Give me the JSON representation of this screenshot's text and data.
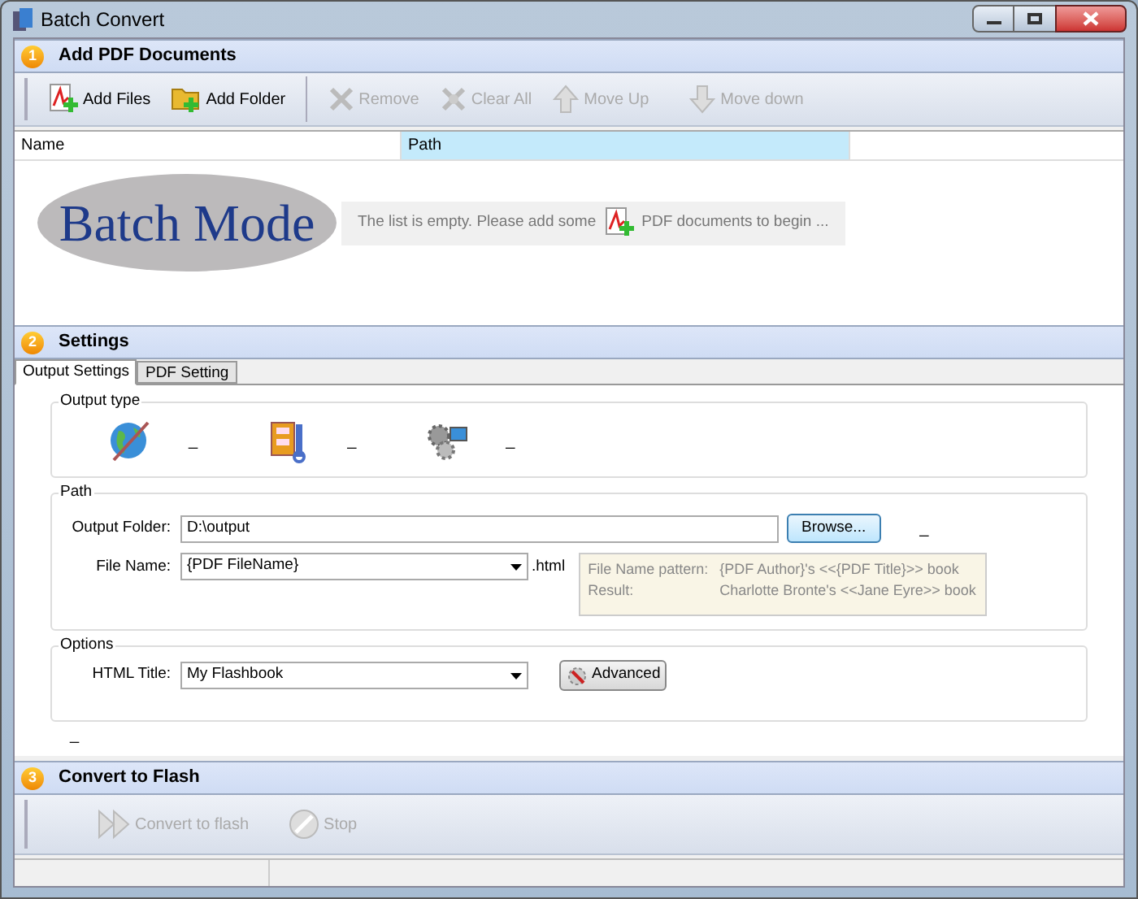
{
  "window": {
    "title": "Batch Convert"
  },
  "add_section": {
    "number": "1",
    "title": "Add PDF Documents",
    "toolbar": [
      {
        "kind": "pdf",
        "label": "Add Files",
        "disabled": false
      },
      {
        "kind": "folder",
        "label": "Add Folder",
        "disabled": false
      },
      {
        "kind": "remove",
        "label": "Remove",
        "disabled": true
      },
      {
        "kind": "clear",
        "label": "Clear All",
        "disabled": true
      },
      {
        "kind": "up",
        "label": "Move Up",
        "disabled": true
      },
      {
        "kind": "down",
        "label": "Move down",
        "disabled": true
      }
    ],
    "columns": [
      {
        "label": "Name",
        "selected": false
      },
      {
        "label": "Path",
        "selected": true
      }
    ],
    "logo": "Batch Mode",
    "empty_message": {
      "before": "The list is empty. Please add some",
      "after": "PDF documents to begin ..."
    }
  },
  "settings_section": {
    "number": "2",
    "title": "Settings",
    "tabs": [
      {
        "label": "Output Settings",
        "selected": true
      },
      {
        "label": "PDF Setting",
        "selected": false
      }
    ],
    "output_type": {
      "title": "Output type",
      "options": [
        {
          "kind": "globe",
          "label": "_"
        },
        {
          "kind": "zip",
          "label": "_"
        },
        {
          "kind": "gears",
          "label": "_"
        }
      ]
    },
    "path": {
      "title": "Path",
      "output_folder": {
        "label": "Output Folder:",
        "value": "D:\\output"
      },
      "browse": "Browse...",
      "browse_note": "_",
      "file_name": {
        "label": "File Name:",
        "value": "{PDF FileName}",
        "suffix": ".html"
      },
      "hint": [
        {
          "label": "File Name pattern:",
          "value": "{PDF Author}'s <<{PDF Title}>> book"
        },
        {
          "label": "Result:",
          "value": "Charlotte Bronte's <<Jane Eyre>> book"
        }
      ]
    },
    "options": {
      "title": "Options",
      "html_title": {
        "label": "HTML Title:",
        "value": "My Flashbook"
      },
      "advanced": "Advanced"
    },
    "footer_note": "_"
  },
  "convert_section": {
    "number": "3",
    "title": "Convert to Flash",
    "toolbar": [
      {
        "kind": "play",
        "label": "Convert to flash",
        "disabled": true
      },
      {
        "kind": "stop",
        "label": "Stop",
        "disabled": true
      }
    ]
  }
}
